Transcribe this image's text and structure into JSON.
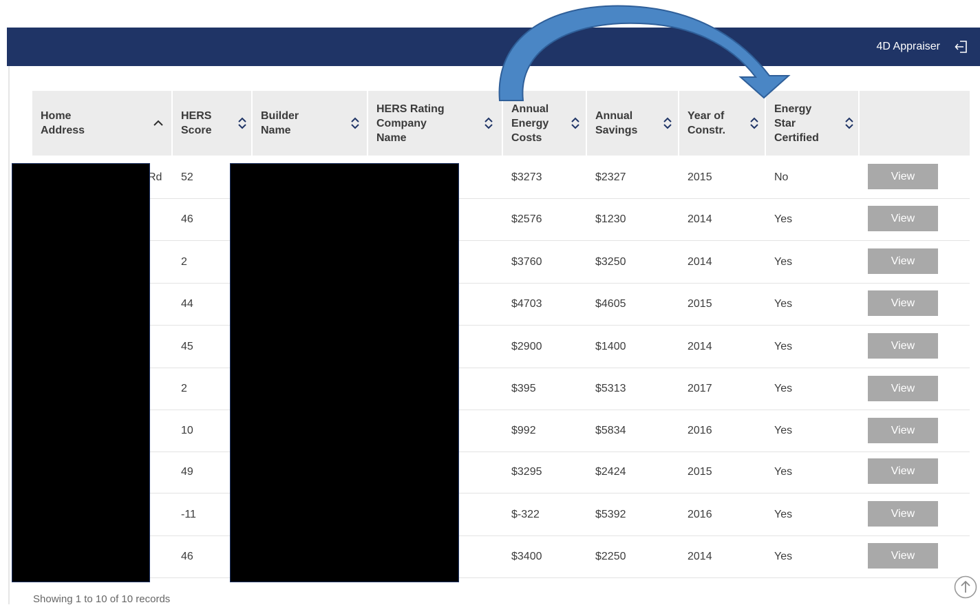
{
  "header": {
    "user_label": "4D Appraiser",
    "logout_icon": "logout-icon"
  },
  "table": {
    "columns": [
      {
        "label": "Home\nAddress",
        "sort_icon": "chevron-up-icon"
      },
      {
        "label": "HERS\nScore",
        "sort_icon": "sort-icon"
      },
      {
        "label": "Builder\nName",
        "sort_icon": "sort-icon"
      },
      {
        "label": "HERS Rating\nCompany\nName",
        "sort_icon": "sort-icon"
      },
      {
        "label": "Annual\nEnergy\nCosts",
        "sort_icon": "sort-icon"
      },
      {
        "label": "Annual\nSavings",
        "sort_icon": "sort-icon"
      },
      {
        "label": "Year of\nConstr.",
        "sort_icon": "sort-icon"
      },
      {
        "label": "Energy\nStar\nCertified",
        "sort_icon": "sort-icon"
      }
    ],
    "rows": [
      {
        "address_tail": "Rd",
        "hers": "52",
        "costs": "$3273",
        "savings": "$2327",
        "year": "2015",
        "energy_star": "No",
        "action": "View"
      },
      {
        "address_tail": "",
        "hers": "46",
        "costs": "$2576",
        "savings": "$1230",
        "year": "2014",
        "energy_star": "Yes",
        "action": "View"
      },
      {
        "address_tail": "",
        "hers": "2",
        "costs": "$3760",
        "savings": "$3250",
        "year": "2014",
        "energy_star": "Yes",
        "action": "View"
      },
      {
        "address_tail": "",
        "hers": "44",
        "costs": "$4703",
        "savings": "$4605",
        "year": "2015",
        "energy_star": "Yes",
        "action": "View"
      },
      {
        "address_tail": "",
        "hers": "45",
        "costs": "$2900",
        "savings": "$1400",
        "year": "2014",
        "energy_star": "Yes",
        "action": "View"
      },
      {
        "address_tail": "",
        "hers": "2",
        "costs": "$395",
        "savings": "$5313",
        "year": "2017",
        "energy_star": "Yes",
        "action": "View"
      },
      {
        "address_tail": "",
        "hers": "10",
        "costs": "$992",
        "savings": "$5834",
        "year": "2016",
        "energy_star": "Yes",
        "action": "View"
      },
      {
        "address_tail": "",
        "hers": "49",
        "costs": "$3295",
        "savings": "$2424",
        "year": "2015",
        "energy_star": "Yes",
        "action": "View"
      },
      {
        "address_tail": "",
        "hers": "-11",
        "costs": "$-322",
        "savings": "$5392",
        "year": "2016",
        "energy_star": "Yes",
        "action": "View"
      },
      {
        "address_tail": "",
        "hers": "46",
        "costs": "$3400",
        "savings": "$2250",
        "year": "2014",
        "energy_star": "Yes",
        "action": "View"
      }
    ]
  },
  "footer": {
    "records_text": "Showing 1 to 10 of 10 records",
    "scroll_icon": "scroll-to-top-icon"
  },
  "colors": {
    "header_bg": "#1f3466",
    "view_button": "#a9a9a9",
    "annotation_arrow": "#3f78b8"
  }
}
